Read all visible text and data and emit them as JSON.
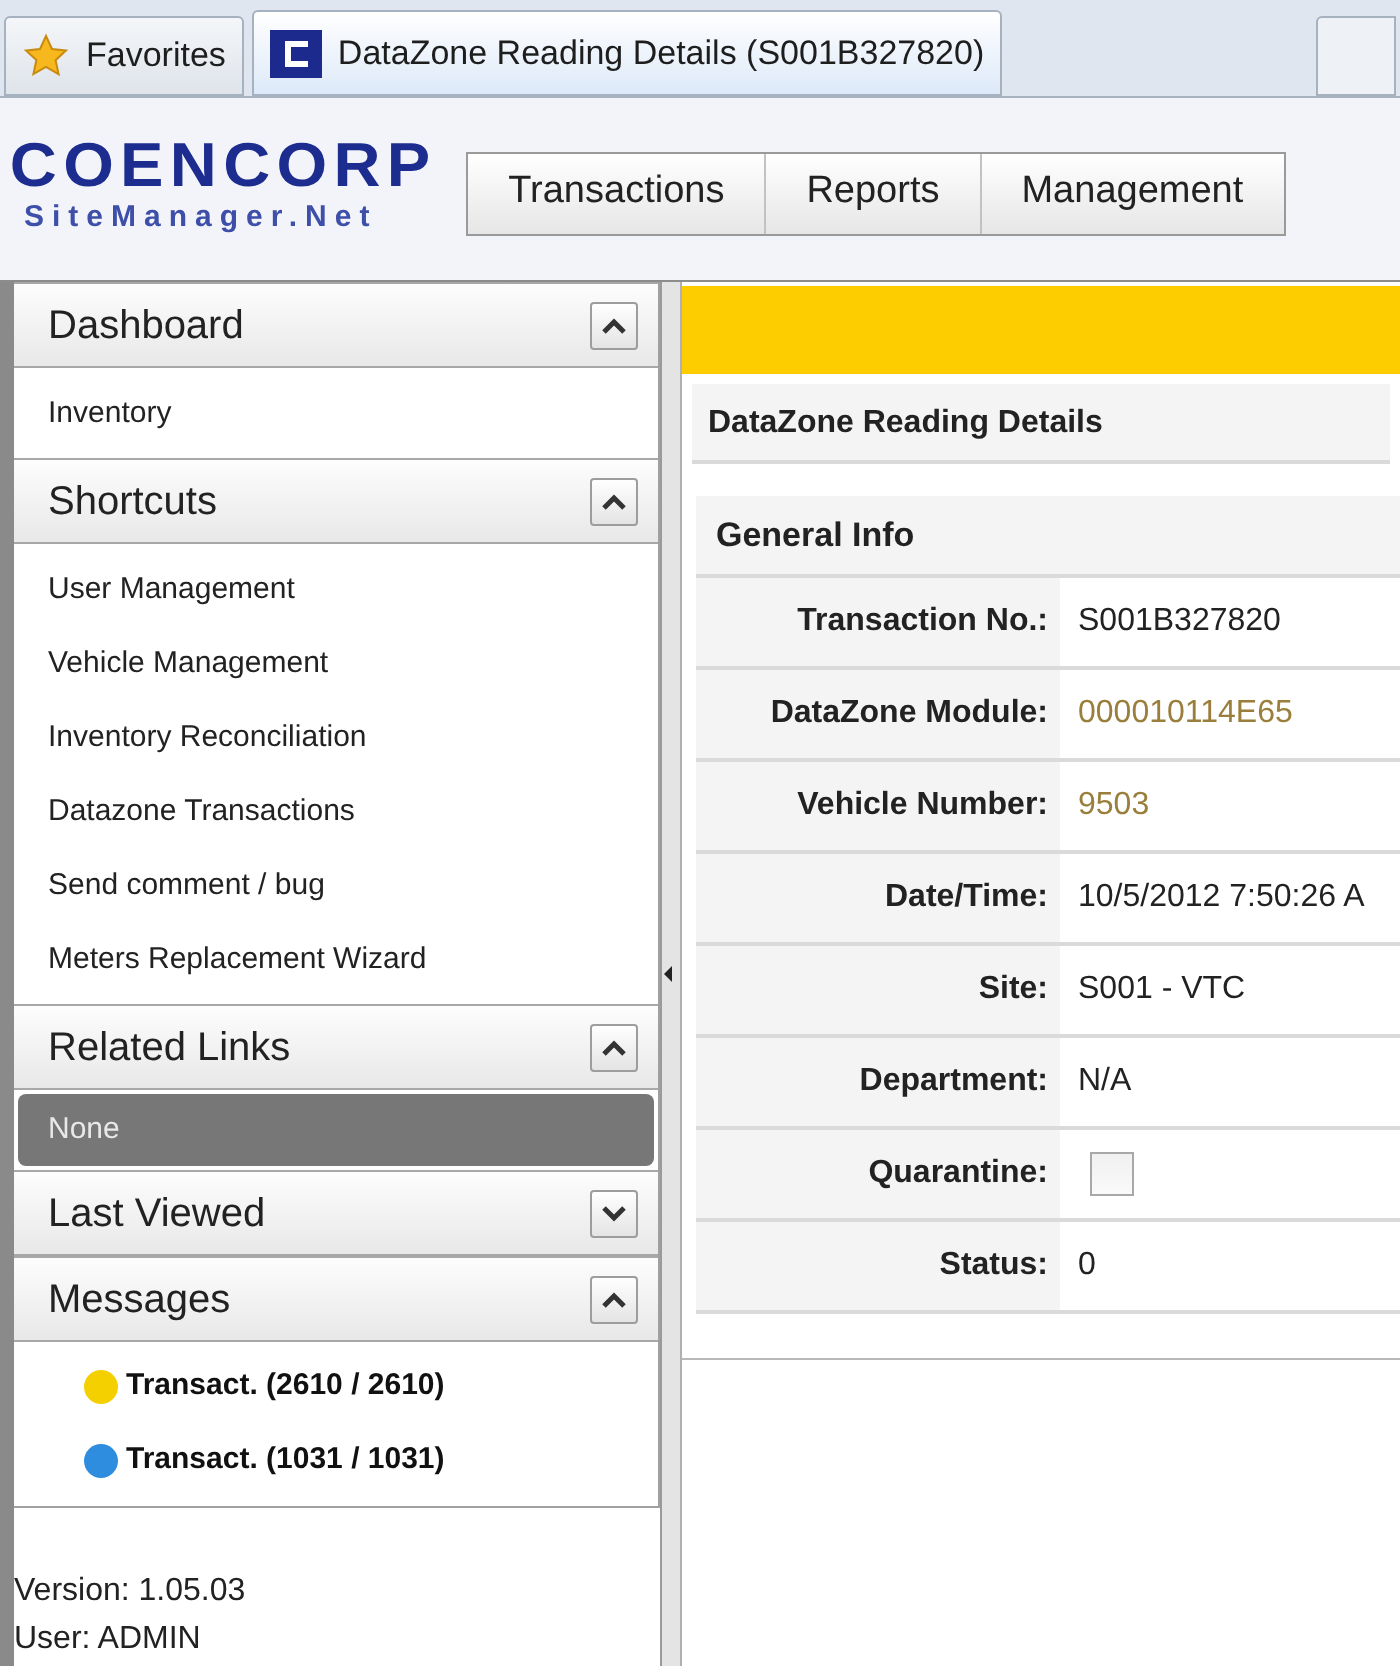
{
  "browser_tabs": [
    {
      "label": "Favorites",
      "kind": "favorites",
      "selected": false
    },
    {
      "label": "DataZone Reading Details (S001B327820)",
      "kind": "page",
      "selected": true
    }
  ],
  "logo": {
    "name": "COENCORP",
    "subtitle": "SiteManager.Net"
  },
  "menu": [
    "Transactions",
    "Reports",
    "Management"
  ],
  "sidebar": {
    "sections": [
      {
        "title": "Dashboard",
        "expanded": true,
        "items": [
          {
            "label": "Inventory",
            "kind": "link"
          }
        ]
      },
      {
        "title": "Shortcuts",
        "expanded": true,
        "items": [
          {
            "label": "User Management",
            "kind": "link"
          },
          {
            "label": "Vehicle Management",
            "kind": "link"
          },
          {
            "label": "Inventory Reconciliation",
            "kind": "link"
          },
          {
            "label": "Datazone Transactions",
            "kind": "link"
          },
          {
            "label": "Send comment / bug",
            "kind": "link"
          },
          {
            "label": "Meters Replacement Wizard",
            "kind": "link"
          }
        ]
      },
      {
        "title": "Related Links",
        "expanded": true,
        "items": [
          {
            "label": "None",
            "kind": "empty"
          }
        ]
      },
      {
        "title": "Last Viewed",
        "expanded": false
      },
      {
        "title": "Messages",
        "expanded": true,
        "items": [
          {
            "label": "Transact. (2610 / 2610)",
            "kind": "message",
            "color": "#f5d000"
          },
          {
            "label": "Transact. (1031 / 1031)",
            "kind": "message",
            "color": "#2f8de0"
          }
        ]
      }
    ],
    "version": "Version: 1.05.03",
    "user": "User: ADMIN"
  },
  "page_title": "DataZone Reading Details",
  "general_info": {
    "title": "General Info",
    "rows": [
      {
        "label": "Transaction No.:",
        "kind": "text",
        "value": "S001B327820"
      },
      {
        "label": "DataZone Module:",
        "kind": "link",
        "value": "000010114E65"
      },
      {
        "label": "Vehicle Number:",
        "kind": "link",
        "value": "9503"
      },
      {
        "label": "Date/Time:",
        "kind": "text",
        "value": "10/5/2012 7:50:26 A"
      },
      {
        "label": "Site:",
        "kind": "text",
        "value": "S001 - VTC"
      },
      {
        "label": "Department:",
        "kind": "text",
        "value": "N/A"
      },
      {
        "label": "Quarantine:",
        "kind": "checkbox",
        "checked": false
      },
      {
        "label": "Status:",
        "kind": "text",
        "value": "0"
      }
    ]
  }
}
